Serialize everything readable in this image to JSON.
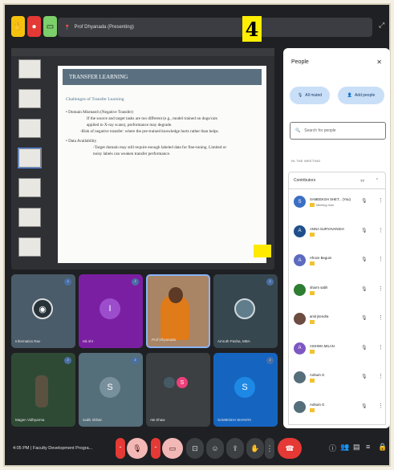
{
  "badge_number": "4",
  "presenter_label": "Prof Dhyanada (Presenting)",
  "slide": {
    "title": "TRANSFER LEARNING",
    "subtitle": "Challenges of Transfer Learning",
    "lines": [
      "• Domain Mismatch (Negative Transfer)",
      "If the source and target tasks are too different (e.g., model trained on dogs/cats",
      "applied to X-ray scans), performance may degrade.",
      "-Risk of negative transfer: where the pre-trained knowledge hurts rather than helps.",
      "• Data Availability",
      "-Target domain may still require enough labeled data for fine-tuning. Limited or",
      "noisy labels can weaken transfer performance."
    ]
  },
  "tiles": [
    {
      "name": "Informatics Rav",
      "initial": ""
    },
    {
      "name": "Isk shr",
      "initial": "I"
    },
    {
      "name": "Prof Dhyanada",
      "initial": ""
    },
    {
      "name": "Amruth Pasha, MBA",
      "initial": ""
    },
    {
      "name": "Magen Vidhyarma",
      "initial": ""
    },
    {
      "name": "sadik shihar",
      "initial": "S"
    },
    {
      "name": "AB Shaw",
      "initial": "S"
    },
    {
      "name": "SAMIKSHA SHANTA",
      "initial": "S"
    }
  ],
  "people": {
    "title": "People",
    "add_label": "All muted",
    "add_people_label": "Add people",
    "search_placeholder": "Search for people",
    "in_meeting_label": "IN THE MEETING",
    "contributors_label": "Contributors",
    "contributors_count": "77",
    "list": [
      {
        "name": "SAMEEKSH SHET... (You)",
        "role": "Meeting host",
        "initial": "S",
        "color": "#3a6fc4"
      },
      {
        "name": "ANNA SURYAVANSHI",
        "role": "",
        "initial": "A",
        "color": "#1f4f8a"
      },
      {
        "name": "Afroze Begum",
        "role": "",
        "initial": "A",
        "color": "#5c6bc0"
      },
      {
        "name": "sharm sabh",
        "role": "",
        "initial": "",
        "color": "#2e7d32"
      },
      {
        "name": "amit jitendra",
        "role": "",
        "initial": "",
        "color": "#6d4c41"
      },
      {
        "name": "AISHWA MILAN",
        "role": "",
        "initial": "A",
        "color": "#7e57c2"
      },
      {
        "name": "Ashwin G",
        "role": "",
        "initial": "",
        "color": "#546e7a"
      },
      {
        "name": "Ashwin G",
        "role": "",
        "initial": "",
        "color": "#546e7a"
      }
    ]
  },
  "bottombar": {
    "time": "4:05 PM",
    "meeting_title": "Faculty Development Progra..."
  }
}
